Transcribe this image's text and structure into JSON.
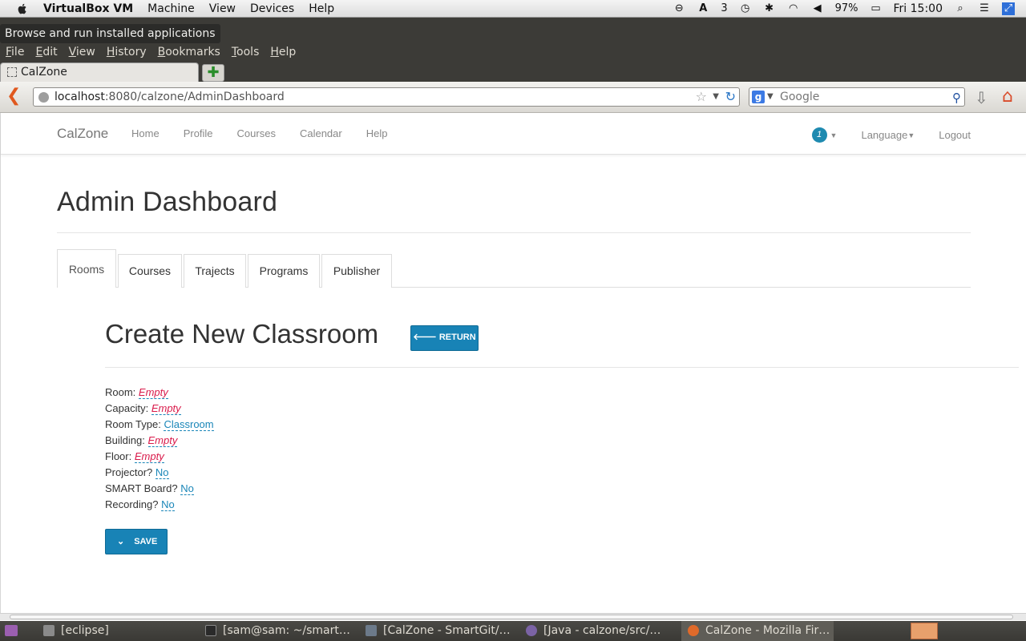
{
  "macbar": {
    "app": "VirtualBox VM",
    "menus": [
      "Machine",
      "View",
      "Devices",
      "Help"
    ],
    "keyboard_indicator": "3",
    "battery": "97%",
    "clock": "Fri 15:00"
  },
  "firefox": {
    "tooltip": "Browse and run installed applications",
    "menus": [
      "File",
      "Edit",
      "View",
      "History",
      "Bookmarks",
      "Tools",
      "Help"
    ],
    "tab_title": "CalZone",
    "new_tab": "✚",
    "url_host": "localhost",
    "url_rest": ":8080/calzone/AdminDashboard",
    "search_placeholder": "Google"
  },
  "site": {
    "brand": "CalZone",
    "nav": [
      "Home",
      "Profile",
      "Courses",
      "Calendar",
      "Help"
    ],
    "notification_count": "1",
    "language": "Language",
    "logout": "Logout"
  },
  "main": {
    "title": "Admin Dashboard",
    "tabs": [
      "Rooms",
      "Courses",
      "Trajects",
      "Programs",
      "Publisher"
    ],
    "active_tab": "Rooms",
    "form_title": "Create New Classroom",
    "return_label": "RETURN",
    "fields": [
      {
        "label": "Room:",
        "value": "Empty",
        "empty": true
      },
      {
        "label": "Capacity:",
        "value": "Empty",
        "empty": true
      },
      {
        "label": "Room Type:",
        "value": "Classroom",
        "empty": false
      },
      {
        "label": "Building:",
        "value": "Empty",
        "empty": true
      },
      {
        "label": "Floor:",
        "value": "Empty",
        "empty": true
      },
      {
        "label": "Projector?",
        "value": "No",
        "empty": false
      },
      {
        "label": "SMART Board?",
        "value": "No",
        "empty": false
      },
      {
        "label": "Recording?",
        "value": "No",
        "empty": false
      }
    ],
    "save_label": "SAVE"
  },
  "taskbar": {
    "tasks": [
      "[eclipse]",
      "[sam@sam: ~/smart…",
      "[CalZone - SmartGit/…",
      "[Java - calzone/src/…",
      "CalZone - Mozilla Fir…"
    ]
  },
  "colors": {
    "accent": "#1883b6",
    "empty_value": "#d91a4a",
    "editable_value": "#1a86b8"
  }
}
